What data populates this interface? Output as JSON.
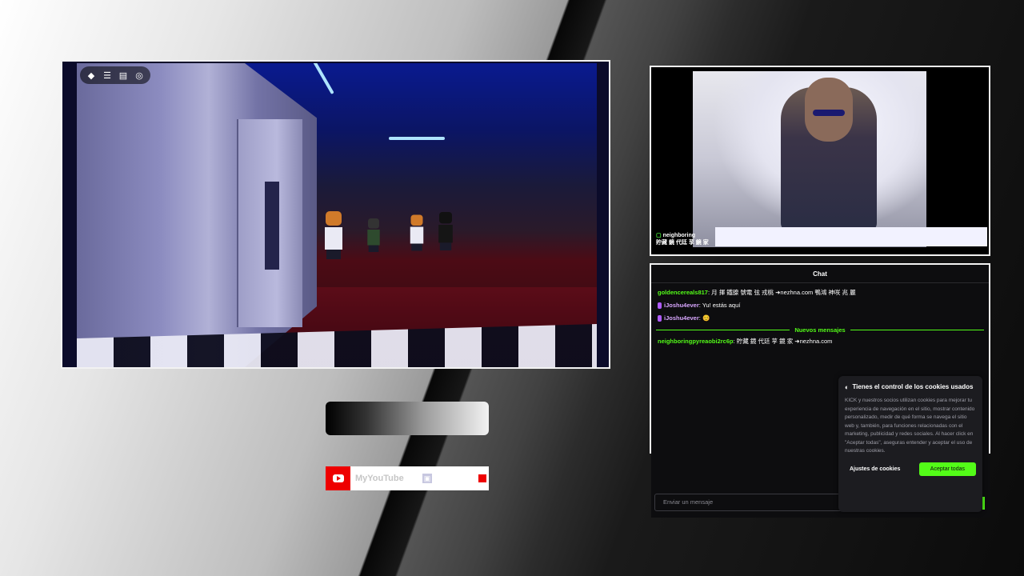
{
  "game": {
    "toolbar_icons": [
      "roblox-icon",
      "menu-icon",
      "chat-icon",
      "backpack-icon"
    ]
  },
  "youtube_bar": {
    "label": "MyYouTube"
  },
  "webcam": {
    "overlay_user": "neighboring",
    "overlay_text": "貯藏 鏡 代廷 莩 鏡 家"
  },
  "chat": {
    "title": "Chat",
    "messages": [
      {
        "user": "goldencereals817",
        "text": ": 月 揮 鐵腺 號電 弦 戎桃 ➜nezhna.com 鴨鴻 神咲 兆 麗"
      },
      {
        "user": "iJoshu4ever",
        "text": ": Yu! estás aquí"
      },
      {
        "user": "iJoshu4ever",
        "text": ": 😊"
      }
    ],
    "new_messages_label": "Nuevos mensajes",
    "after_messages": [
      {
        "user": "neighboringpyreaobi2rc6p",
        "text": ": 貯藏 鏡 代廷 莩 鏡 家 ➜nezhna.com"
      }
    ],
    "input_placeholder": "Enviar un mensaje"
  },
  "cookie": {
    "title": "Tienes el control de los cookies usados",
    "body": "KICK y nuestros socios utilizan cookies para mejorar tu experiencia de navegación en el sitio, mostrar contenido personalizado, medir de qué forma se navega el sitio web y, también, para funciones relacionadas con el marketing, publicidad y redes sociales. Al hacer click en \"Aceptar todas\", aseguras entender y aceptar el uso de nuestras cookies.",
    "settings_button": "Ajustes de cookies",
    "accept_button": "Aceptar todas"
  },
  "colors": {
    "kick_green": "#53fc18",
    "youtube_red": "#ee0000"
  }
}
